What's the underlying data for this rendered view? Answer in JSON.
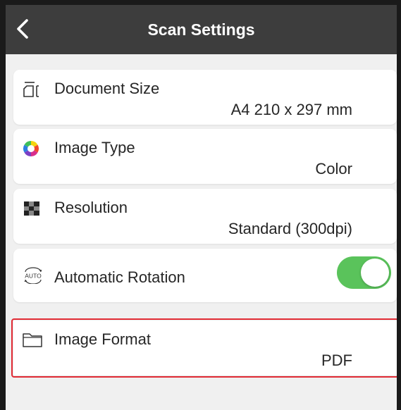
{
  "header": {
    "title": "Scan Settings",
    "back_icon": "chevron-left-icon"
  },
  "settings": [
    {
      "icon": "document-size-icon",
      "label": "Document Size",
      "value": "A4 210 x 297 mm"
    },
    {
      "icon": "color-wheel-icon",
      "label": "Image Type",
      "value": "Color"
    },
    {
      "icon": "resolution-checker-icon",
      "label": "Resolution",
      "value": "Standard (300dpi)"
    },
    {
      "icon": "auto-rotate-icon",
      "icon_text": "AUTO",
      "label": "Automatic Rotation",
      "toggle_on": true
    },
    {
      "icon": "folder-icon",
      "label": "Image Format",
      "value": "PDF",
      "highlighted": true
    }
  ],
  "colors": {
    "navbar": "#3d3d3d",
    "background": "#f0f0f0",
    "toggle_on": "#5ac35b",
    "highlight_border": "#e12b35"
  }
}
